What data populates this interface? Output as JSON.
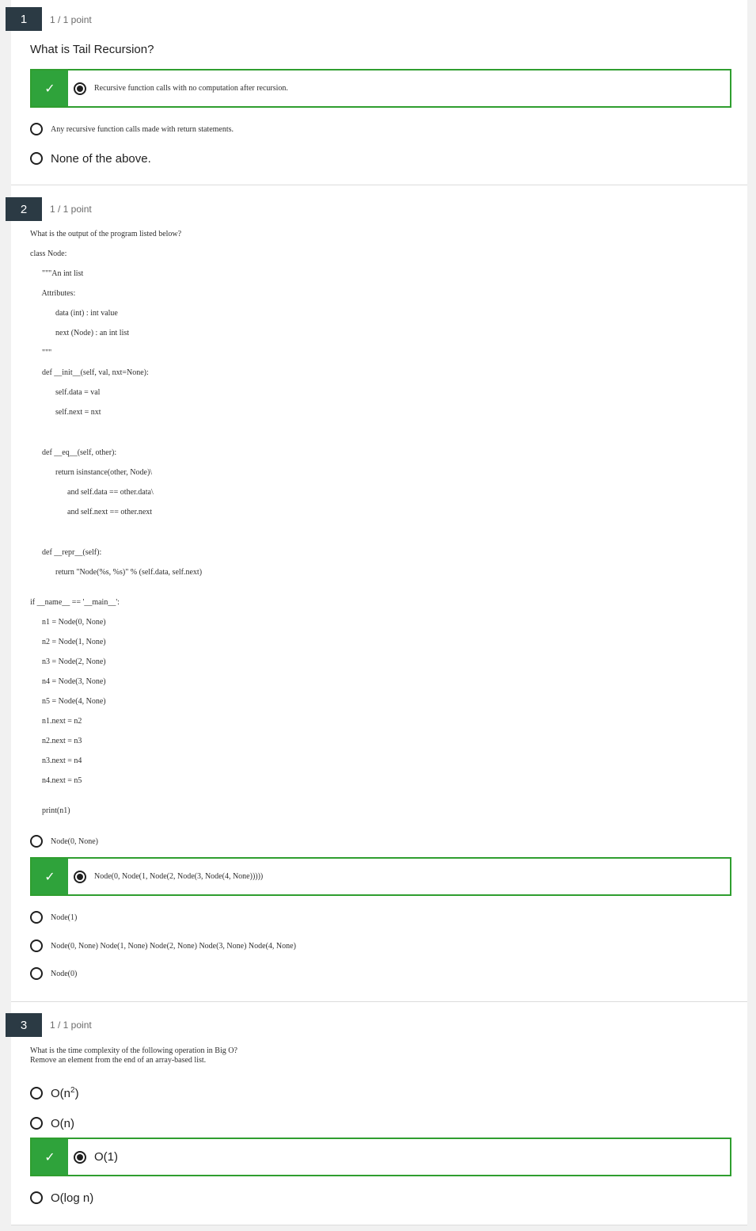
{
  "questions": [
    {
      "number": "1",
      "points": "1 / 1 point",
      "title": "What is Tail Recursion?",
      "options": [
        {
          "label": "Recursive function calls with no computation after recursion.",
          "correct": true
        },
        {
          "label": "Any recursive function calls made with return statements.",
          "correct": false
        },
        {
          "label": "None of the above.",
          "correct": false
        }
      ]
    },
    {
      "number": "2",
      "points": "1 / 1 point",
      "title": "What is the output of the program listed below?",
      "code": [
        "class Node:",
        "  \"\"\"An int list",
        "  Attributes:",
        "    data (int) : int value",
        "    next (Node) : an int list",
        "  \"\"\"",
        "  def __init__(self, val, nxt=None):",
        "    self.data = val",
        "    self.next = nxt",
        "  def __eq__(self, other):",
        "    return isinstance(other, Node)\\",
        "      and self.data == other.data\\",
        "      and self.next == other.next",
        "  def __repr__(self):",
        "    return \"Node(%s, %s)\" % (self.data, self.next)",
        "if __name__ == '__main__':",
        "  n1 = Node(0, None)",
        "  n2 = Node(1, None)",
        "  n3 = Node(2, None)",
        "  n4 = Node(3, None)",
        "  n5 = Node(4, None)",
        "  n1.next = n2",
        "  n2.next = n3",
        "  n3.next = n4",
        "  n4.next = n5",
        "  print(n1)"
      ],
      "options": [
        {
          "label": "Node(0, None)",
          "correct": false
        },
        {
          "label": "Node(0, Node(1, Node(2, Node(3, Node(4, None)))))",
          "correct": true
        },
        {
          "label": "Node(1)",
          "correct": false
        },
        {
          "label": "Node(0, None) Node(1, None) Node(2, None) Node(3, None) Node(4, None)",
          "correct": false
        },
        {
          "label": "Node(0)",
          "correct": false
        }
      ]
    },
    {
      "number": "3",
      "points": "1 / 1 point",
      "title_line1": "What is the time complexity of the following operation in Big O?",
      "title_line2": "Remove an element from the end of an array-based list.",
      "options": [
        {
          "label_base": "O(n",
          "label_sup": "2",
          "label_end": ")",
          "correct": false
        },
        {
          "label": "O(n)",
          "correct": false
        },
        {
          "label": "O(1)",
          "correct": true
        },
        {
          "label": "O(log n)",
          "correct": false
        }
      ]
    }
  ],
  "icons": {
    "check": "check-icon"
  },
  "colors": {
    "correct_green": "#2fa33b",
    "number_badge": "#2b3a44"
  }
}
